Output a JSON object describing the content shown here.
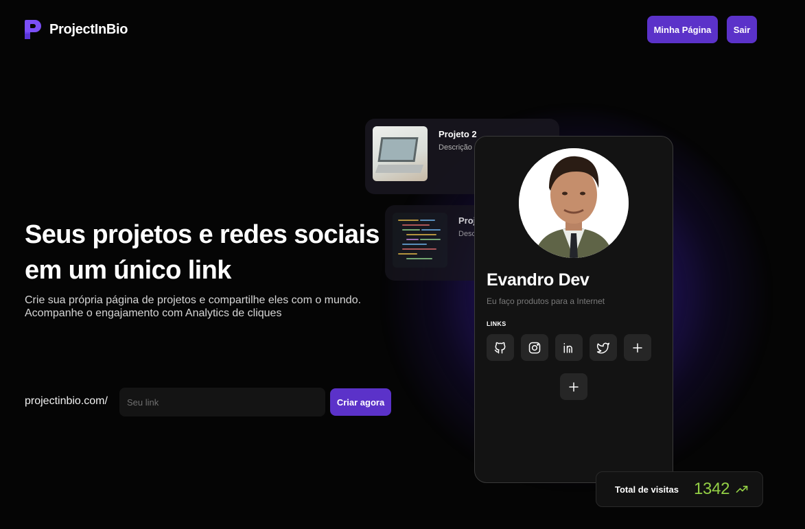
{
  "header": {
    "logo_text": "ProjectInBio",
    "my_page_label": "Minha Página",
    "logout_label": "Sair",
    "brand_color": "#5b32c9"
  },
  "hero": {
    "title_line1": "Seus projetos e redes sociais",
    "title_line2": "em um único link",
    "subtitle_line1": "Crie sua própria página de projetos e compartilhe eles com o mundo.",
    "subtitle_line2": "Acompanhe o engajamento com Analytics de cliques",
    "url_prefix": "projectinbio.com/",
    "link_placeholder": "Seu link",
    "link_value": "",
    "create_label": "Criar agora"
  },
  "projects": [
    {
      "title": "Projeto 2",
      "description": "Descrição",
      "thumb": "laptop-photo"
    },
    {
      "title": "Proj",
      "description": "Desc",
      "thumb": "code-photo"
    }
  ],
  "profile": {
    "name": "Evandro Dev",
    "bio": "Eu faço produtos para a Internet",
    "links_label": "LINKS",
    "socials": [
      "github-icon",
      "instagram-icon",
      "linkedin-icon",
      "twitter-icon",
      "plus-icon"
    ]
  },
  "visits": {
    "label": "Total de visitas",
    "count": "1342",
    "trend": "up",
    "count_color": "#93cf45"
  }
}
